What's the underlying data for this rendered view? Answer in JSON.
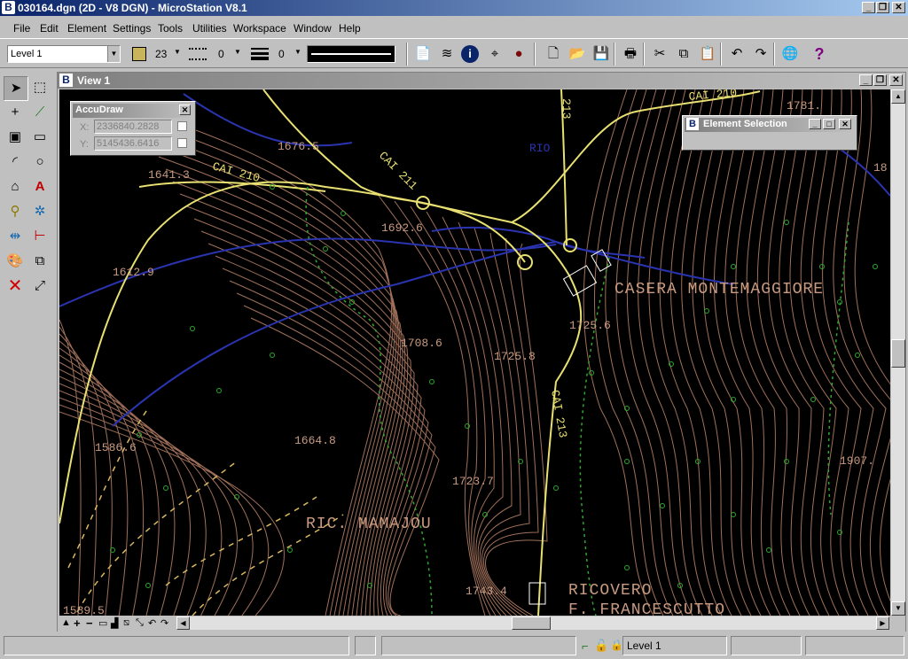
{
  "window": {
    "title": "030164.dgn (2D - V8 DGN) - MicroStation V8.1",
    "icon_glyph": "B"
  },
  "menu": [
    "File",
    "Edit",
    "Element",
    "Settings",
    "Tools",
    "Utilities",
    "Workspace",
    "Window",
    "Help"
  ],
  "toolbar": {
    "level": "Level 1",
    "color_index": "23",
    "style_index": "0",
    "weight_index": "0",
    "color_swatch": "#c8b45a"
  },
  "view": {
    "title": "View 1"
  },
  "accudraw": {
    "title": "AccuDraw",
    "x_label": "X:",
    "x_value": "2336840.2828",
    "y_label": "Y:",
    "y_value": "5145436.6416"
  },
  "element_selection": {
    "title": "Element Selection"
  },
  "map_labels": {
    "cai210_a": "CAI 210",
    "cai210_b": "CAI 210",
    "cai211": "CAI 211",
    "cai213": "CAI 213",
    "cai213_top": "213",
    "rio": "RIO",
    "e1676": "1676.5",
    "e1641": "1641.3",
    "e1692": "1692.6",
    "e1612": "1612.9",
    "e1708": "1708.6",
    "e1725_8": "1725.8",
    "e1725_6": "1725.6",
    "e1664": "1664.8",
    "e1586": "1586.6",
    "e1723": "1723.7",
    "e1743": "1743.4",
    "e1907": "1907.",
    "e1781": "1781.",
    "e18": "18",
    "e1589": "1589.5",
    "casera": "CASERA MONTEMAGGIORE",
    "ricmam": "RIC. MAMAJOU",
    "ricovero": "RICOVERO",
    "francescutto": "F. FRANCESCUTTO"
  },
  "status": {
    "level": "Level 1"
  },
  "colors": {
    "titlebar_active": "#0a246a",
    "contour": "#a0705a",
    "road": "#e8e070",
    "water": "#2a34b0",
    "forest_boundary": "#2ea82e",
    "label": "#c89a80"
  }
}
